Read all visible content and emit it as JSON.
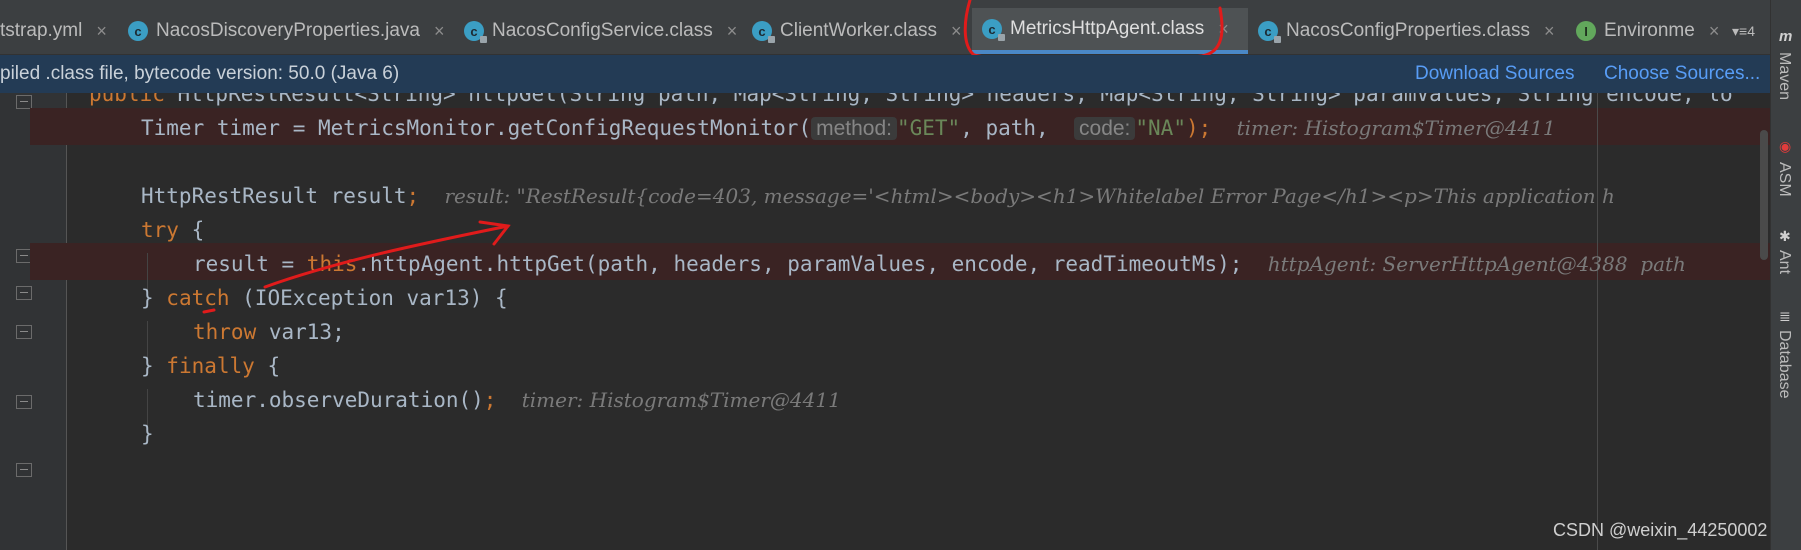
{
  "tabs": [
    {
      "label": "tstrap.yml",
      "icon": "yaml-file-icon",
      "active": false
    },
    {
      "label": "NacosDiscoveryProperties.java",
      "icon": "java-class-icon",
      "active": false
    },
    {
      "label": "NacosConfigService.class",
      "icon": "compiled-class-icon",
      "active": false
    },
    {
      "label": "ClientWorker.class",
      "icon": "compiled-class-icon",
      "active": false
    },
    {
      "label": "MetricsHttpAgent.class",
      "icon": "compiled-class-icon",
      "active": true
    },
    {
      "label": "NacosConfigProperties.class",
      "icon": "compiled-class-icon",
      "active": false
    },
    {
      "label": "Environme",
      "icon": "interface-icon",
      "active": false
    }
  ],
  "tab_overflow": "4",
  "banner": {
    "text": "piled .class file, bytecode version: 50.0 (Java 6)",
    "download_sources": "Download Sources",
    "choose_sources": "Choose Sources..."
  },
  "code": {
    "line1": {
      "kw": "public",
      "rest": " HttpRestResult<String> httpGet(String path, Map<String, String> headers, Map<String, String> paramValues, String encode, lo"
    },
    "line2": {
      "pre": "Timer timer = MetricsMonitor.getConfigRequestMonitor(",
      "hint1": "method:",
      "s1": "\"GET\"",
      "mid": ", path, ",
      "hint2": "code:",
      "s2": "\"NA\"",
      "end": ");",
      "inline": "timer: Histogram$Timer@4411"
    },
    "line3": {
      "text": ""
    },
    "line4": {
      "pre": "HttpRestResult result",
      "semi": ";",
      "inline": "result: \"RestResult{code=403, message='<html><body><h1>Whitelabel Error Page</h1><p>This application h"
    },
    "line5": {
      "kw": "try",
      "rest": " {"
    },
    "line6": {
      "pre": "result = ",
      "kw": "this",
      "rest": ".httpAgent.httpGet(path, headers, paramValues, encode, readTimeoutMs);",
      "inline": "httpAgent: ServerHttpAgent@4388  path"
    },
    "line7": {
      "pre": "} ",
      "kw": "catch",
      "rest": " (IOException var13) {"
    },
    "line8": {
      "kw": "throw",
      "rest": " var13;"
    },
    "line9": {
      "pre": "} ",
      "kw": "finally",
      "rest": " {"
    },
    "line10": {
      "pre": "timer.observeDuration()",
      "semi": ";",
      "inline": "timer: Histogram$Timer@4411"
    },
    "line11": {
      "text": "}"
    }
  },
  "right_tools": [
    "Maven",
    "ASM",
    "Ant",
    "Database"
  ],
  "watermark": "CSDN @weixin_44250002"
}
